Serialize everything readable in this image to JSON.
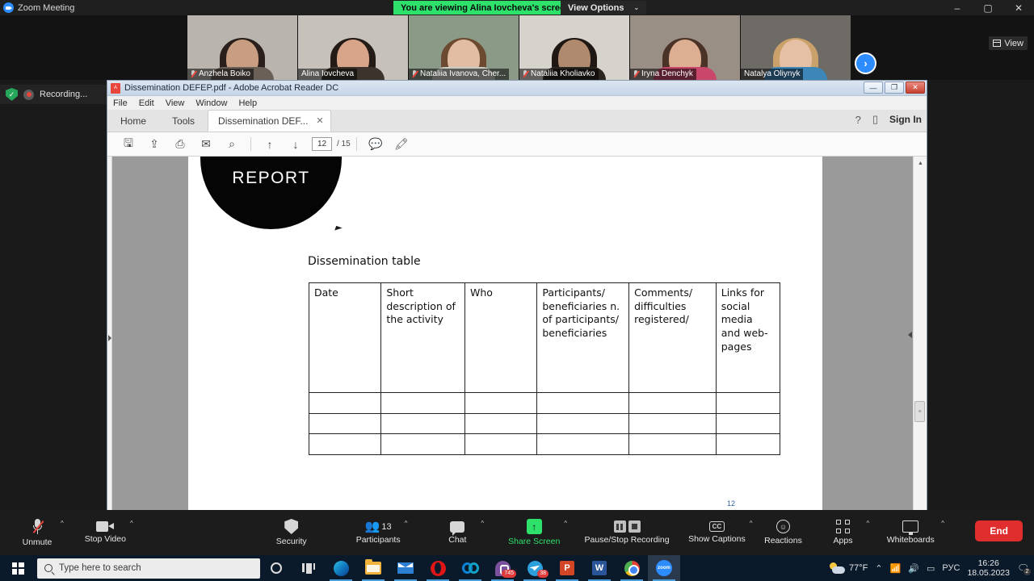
{
  "zoom_window": {
    "app_title": "Zoom Meeting",
    "share_banner": "You are viewing Alina Iovcheva's screen",
    "view_options": "View Options",
    "view_options_caret": "⌄",
    "view_button": "View",
    "next_arrow": "›",
    "minimize": "–",
    "maximize": "▢",
    "close": "✕"
  },
  "recording_indicator": {
    "label": "Recording...",
    "shield_icon": "shield-check-icon"
  },
  "participants": [
    {
      "name": "Anzhela Boiko",
      "muted": true,
      "active": false,
      "bg": "#b9b4ad",
      "hair": "#2a1f1a",
      "skin": "#c99d82",
      "body": "#6a6058"
    },
    {
      "name": "Alina Iovcheva",
      "muted": false,
      "active": true,
      "bg": "#c6c1bb",
      "hair": "#241b16",
      "skin": "#d9a589",
      "body": "#3c332c"
    },
    {
      "name": "Nataliia Ivanova, Cher...",
      "muted": true,
      "active": false,
      "bg": "#8a9a86",
      "hair": "#6b4a31",
      "skin": "#e2bda3",
      "body": "#c9ccc2"
    },
    {
      "name": "Nataliia Kholiavko",
      "muted": true,
      "active": false,
      "bg": "#d6d3cd",
      "hair": "#1f1713",
      "skin": "#b08a6f",
      "body": "#2b2520"
    },
    {
      "name": "Iryna Denchyk",
      "muted": true,
      "active": false,
      "bg": "#9a8f85",
      "hair": "#4a3326",
      "skin": "#dcae92",
      "body": "#c8476a"
    },
    {
      "name": "Natalya Oliynyk",
      "muted": false,
      "active": false,
      "bg": "#6e6a66",
      "hair": "#caa16a",
      "skin": "#e6c0a4",
      "body": "#3d86b8"
    }
  ],
  "acrobat": {
    "window_title": "Dissemination DEFEP.pdf - Adobe Acrobat Reader DC",
    "pdf_badge": "A",
    "menu": [
      "File",
      "Edit",
      "View",
      "Window",
      "Help"
    ],
    "tabs": {
      "home": "Home",
      "tools": "Tools",
      "document": "Dissemination DEF...",
      "close_tab": "✕"
    },
    "right_controls": {
      "help_icon": "?",
      "mobile_icon": "▯",
      "sign_in": "Sign In"
    },
    "toolbar_icons": [
      {
        "name": "save-icon",
        "glyph": "🖫"
      },
      {
        "name": "upload-cloud-icon",
        "glyph": "⇪"
      },
      {
        "name": "print-icon",
        "glyph": "⎙"
      },
      {
        "name": "email-icon",
        "glyph": "✉"
      },
      {
        "name": "search-icon",
        "glyph": "⌕"
      }
    ],
    "nav": {
      "prev_icon": "↑",
      "next_icon": "↓",
      "current_page": "12",
      "total_pages": "/ 15"
    },
    "annot_icons": [
      {
        "name": "comment-icon",
        "glyph": "💬"
      },
      {
        "name": "highlight-icon",
        "glyph": "🖍"
      }
    ],
    "window_buttons": {
      "minimize": "—",
      "restore": "❐",
      "close": "✕"
    },
    "scrollbar": {
      "up_arrow": "▲",
      "down_arrow": "▼",
      "thumb": "≡"
    }
  },
  "pdf_document": {
    "report_badge": "REPORT",
    "section_title": "Dissemination table",
    "page_number_marker": "12",
    "table": {
      "headers": [
        "Date",
        "Short description of the activity",
        "Who",
        "Participants/ beneficiaries n. of participants/ beneficiaries",
        "Comments/ difficulties registered/",
        "Links for social media and web-pages"
      ],
      "empty_rows": 3
    }
  },
  "zoom_toolbar": {
    "items": [
      {
        "label": "Unmute",
        "icon": "microphone-muted-icon",
        "has_caret": true,
        "green": false
      },
      {
        "label": "Stop Video",
        "icon": "camera-icon",
        "has_caret": true,
        "green": false
      },
      {
        "label": "Security",
        "icon": "shield-icon",
        "has_caret": false,
        "green": false
      },
      {
        "label": "Participants",
        "icon": "people-icon",
        "count": "13",
        "has_caret": true,
        "green": false
      },
      {
        "label": "Chat",
        "icon": "chat-bubble-icon",
        "has_caret": true,
        "green": false
      },
      {
        "label": "Share Screen",
        "icon": "share-screen-icon",
        "has_caret": true,
        "green": true
      },
      {
        "label": "Pause/Stop Recording",
        "icon": "pause-stop-recording-icon",
        "has_caret": false,
        "green": false
      },
      {
        "label": "Show Captions",
        "icon": "closed-captions-icon",
        "has_caret": true,
        "green": false
      },
      {
        "label": "Reactions",
        "icon": "reactions-icon",
        "has_caret": false,
        "green": false
      },
      {
        "label": "Apps",
        "icon": "apps-icon",
        "has_caret": true,
        "green": false,
        "boxed": true
      },
      {
        "label": "Whiteboards",
        "icon": "whiteboard-icon",
        "has_caret": true,
        "green": false
      }
    ],
    "end_button": "End"
  },
  "taskbar": {
    "start_icon": "windows-start-icon",
    "search_placeholder": "Type here to search",
    "pinned": [
      {
        "name": "cortana-icon"
      },
      {
        "name": "task-view-icon"
      },
      {
        "name": "edge-icon"
      },
      {
        "name": "file-explorer-icon"
      },
      {
        "name": "mail-icon"
      },
      {
        "name": "opera-icon"
      },
      {
        "name": "meta-icon"
      },
      {
        "name": "viber-icon",
        "badge": "745"
      },
      {
        "name": "telegram-icon",
        "badge": "38"
      },
      {
        "name": "powerpoint-icon",
        "letter": "P"
      },
      {
        "name": "word-icon",
        "letter": "W"
      },
      {
        "name": "chrome-icon"
      },
      {
        "name": "zoom-icon",
        "letter": "zoom"
      }
    ],
    "tray": {
      "temperature": "77°F",
      "chevron": "⌃",
      "wifi_icon": "📶",
      "volume_icon": "🔊",
      "battery_icon": "▭",
      "language": "РУС",
      "time": "16:26",
      "date": "18.05.2023",
      "notification_count": "2"
    }
  }
}
